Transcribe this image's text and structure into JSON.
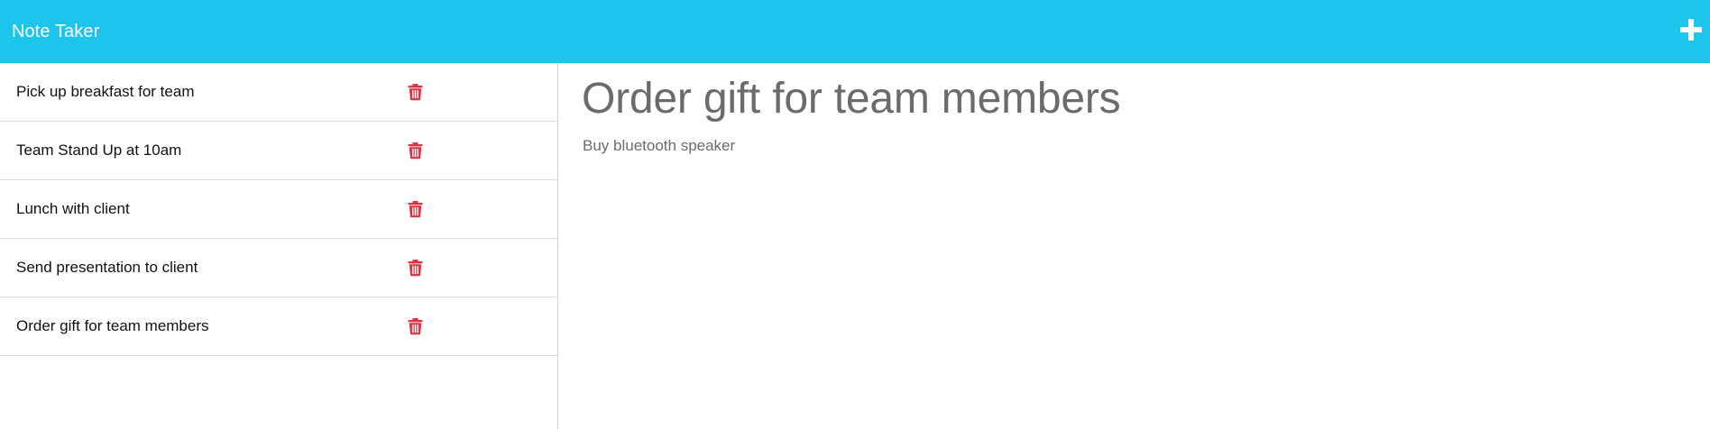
{
  "header": {
    "title": "Note Taker",
    "add_icon": "plus-icon"
  },
  "sidebar": {
    "items": [
      {
        "title": "Pick up breakfast for team",
        "action_icon": "trash-icon"
      },
      {
        "title": "Team Stand Up at 10am",
        "action_icon": "trash-icon"
      },
      {
        "title": "Lunch with client",
        "action_icon": "trash-icon"
      },
      {
        "title": "Send presentation to client",
        "action_icon": "trash-icon"
      },
      {
        "title": "Order gift for team members",
        "action_icon": "trash-icon"
      }
    ]
  },
  "editor": {
    "title": "Order gift for team members",
    "text": "Buy bluetooth speaker"
  },
  "colors": {
    "navbar": "#1dc4eb",
    "delete": "#dc3545",
    "note_text": "#6b6b6b"
  }
}
